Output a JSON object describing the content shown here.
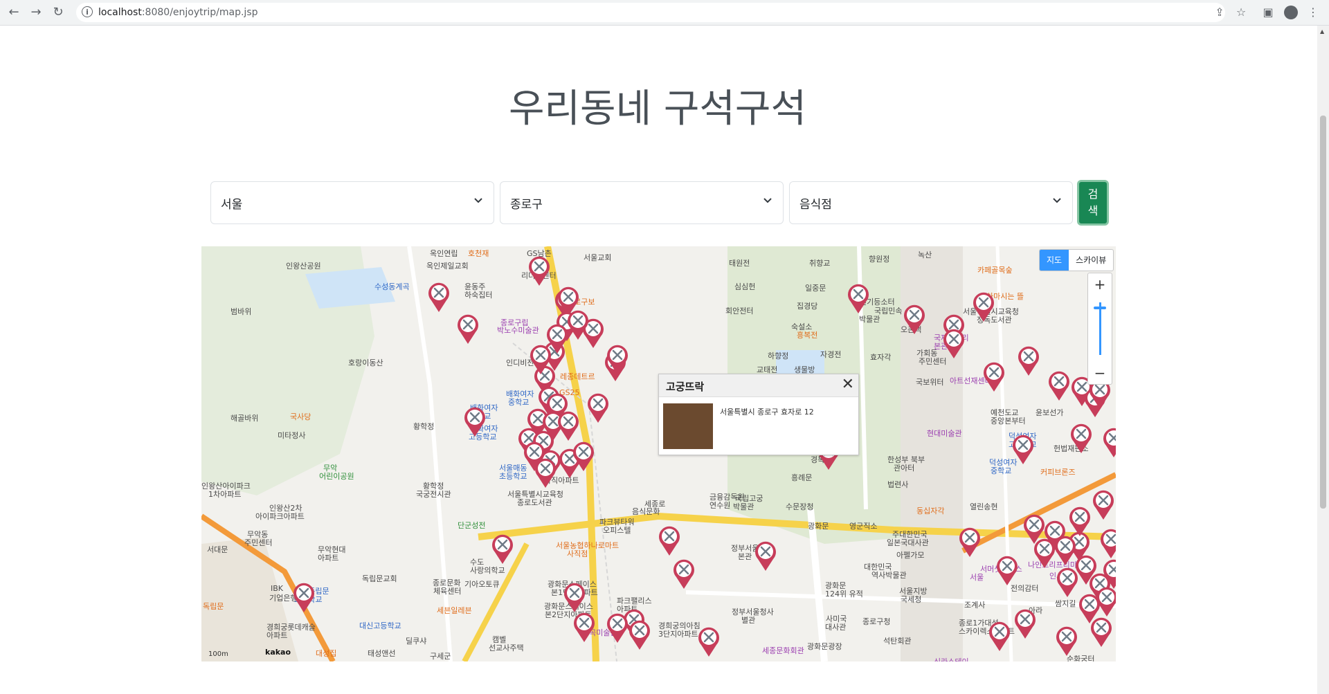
{
  "browser": {
    "url_host": "localhost",
    "url_rest": ":8080/enjoytrip/map.jsp"
  },
  "page": {
    "title": "우리동네 구석구석"
  },
  "filters": {
    "sido": "서울",
    "gugun": "종로구",
    "content_type": "음식점",
    "search_label": "검\n색"
  },
  "map": {
    "type_buttons": [
      "지도",
      "스카이뷰"
    ],
    "zoom_in": "+",
    "zoom_out": "−",
    "scale_text": "100m",
    "logo_text": "kakao",
    "popup": {
      "name": "고궁뜨락",
      "address": "서울특별시 종로구 효자로 12"
    },
    "labels": [
      {
        "text": "옥인연립",
        "cls": ""
      },
      {
        "text": "호천재",
        "cls": "orange"
      },
      {
        "text": "GS남촌",
        "cls": ""
      },
      {
        "text": "서울교회",
        "cls": ""
      },
      {
        "text": "인왕산공원",
        "cls": ""
      },
      {
        "text": "옥인제일교회",
        "cls": ""
      },
      {
        "text": "윤동주",
        "cls": ""
      },
      {
        "text": "하숙집터",
        "cls": ""
      },
      {
        "text": "수성동계곡",
        "cls": "blue"
      },
      {
        "text": "리더십센터",
        "cls": ""
      },
      {
        "text": "종로구보",
        "cls": "orange"
      },
      {
        "text": "범바위",
        "cls": ""
      },
      {
        "text": "종로구립",
        "cls": "purple"
      },
      {
        "text": "박노수미술관",
        "cls": "purple"
      },
      {
        "text": "인디비전",
        "cls": ""
      },
      {
        "text": "호랑이동산",
        "cls": ""
      },
      {
        "text": "레종데트르",
        "cls": "orange"
      },
      {
        "text": "배화여자",
        "cls": "blue"
      },
      {
        "text": "중학교",
        "cls": "blue"
      },
      {
        "text": "배화여자",
        "cls": "blue"
      },
      {
        "text": "대학교",
        "cls": "blue"
      },
      {
        "text": "GS25",
        "cls": "orange"
      },
      {
        "text": "해골바위",
        "cls": ""
      },
      {
        "text": "국사당",
        "cls": "orange"
      },
      {
        "text": "배화여자",
        "cls": "blue"
      },
      {
        "text": "고등학교",
        "cls": "blue"
      },
      {
        "text": "미타정사",
        "cls": ""
      },
      {
        "text": "황학정",
        "cls": ""
      },
      {
        "text": "무악",
        "cls": "green"
      },
      {
        "text": "어린이공원",
        "cls": "green"
      },
      {
        "text": "서울매동",
        "cls": "blue"
      },
      {
        "text": "초등학교",
        "cls": "blue"
      },
      {
        "text": "사직아파트",
        "cls": ""
      },
      {
        "text": "황학정",
        "cls": ""
      },
      {
        "text": "국궁전시관",
        "cls": ""
      },
      {
        "text": "서울특별시교육청",
        "cls": ""
      },
      {
        "text": "종로도서관",
        "cls": ""
      },
      {
        "text": "인왕산아이파크",
        "cls": ""
      },
      {
        "text": "1차아파트",
        "cls": ""
      },
      {
        "text": "인왕산2차",
        "cls": ""
      },
      {
        "text": "아이파크아파트",
        "cls": ""
      },
      {
        "text": "무악동",
        "cls": ""
      },
      {
        "text": "주민센터",
        "cls": ""
      },
      {
        "text": "단군성전",
        "cls": "green"
      },
      {
        "text": "파크뷰타워",
        "cls": ""
      },
      {
        "text": "오피스텔",
        "cls": ""
      },
      {
        "text": "무악현대",
        "cls": ""
      },
      {
        "text": "아파트",
        "cls": ""
      },
      {
        "text": "수도",
        "cls": ""
      },
      {
        "text": "사랑의학교",
        "cls": ""
      },
      {
        "text": "서울농협하나로마트",
        "cls": "orange"
      },
      {
        "text": "사직점",
        "cls": "orange"
      },
      {
        "text": "독립문교회",
        "cls": ""
      },
      {
        "text": "종로문화",
        "cls": ""
      },
      {
        "text": "체육센터",
        "cls": ""
      },
      {
        "text": "기아오토큐",
        "cls": ""
      },
      {
        "text": "광화문스페이스",
        "cls": ""
      },
      {
        "text": "본1단지아파트",
        "cls": ""
      },
      {
        "text": "파크팰리스",
        "cls": ""
      },
      {
        "text": "아파트",
        "cls": ""
      },
      {
        "text": "IBK",
        "cls": ""
      },
      {
        "text": "기업은행",
        "cls": ""
      },
      {
        "text": "서울독립문",
        "cls": "blue"
      },
      {
        "text": "초등학교",
        "cls": "blue"
      },
      {
        "text": "세븐일레븐",
        "cls": "orange"
      },
      {
        "text": "광화문스페이스",
        "cls": ""
      },
      {
        "text": "본2단지아파트",
        "cls": ""
      },
      {
        "text": "경희궁의아침",
        "cls": ""
      },
      {
        "text": "3단지아파트",
        "cls": ""
      },
      {
        "text": "경희궁롯데캐슬",
        "cls": ""
      },
      {
        "text": "아파트",
        "cls": ""
      },
      {
        "text": "대신고등학교",
        "cls": "blue"
      },
      {
        "text": "캠벨",
        "cls": ""
      },
      {
        "text": "선교사주택",
        "cls": ""
      },
      {
        "text": "성곡미술관",
        "cls": "purple"
      },
      {
        "text": "딜쿠샤",
        "cls": ""
      },
      {
        "text": "대성집",
        "cls": "orange"
      },
      {
        "text": "태성앤선",
        "cls": ""
      },
      {
        "text": "구세군",
        "cls": ""
      },
      {
        "text": "태원전",
        "cls": ""
      },
      {
        "text": "취향교",
        "cls": ""
      },
      {
        "text": "향원정",
        "cls": ""
      },
      {
        "text": "녹산",
        "cls": ""
      },
      {
        "text": "카페골목숲",
        "cls": "orange"
      },
      {
        "text": "심심헌",
        "cls": ""
      },
      {
        "text": "일중문",
        "cls": ""
      },
      {
        "text": "전기등소터",
        "cls": ""
      },
      {
        "text": "국립민속",
        "cls": ""
      },
      {
        "text": "박물관",
        "cls": ""
      },
      {
        "text": "차마시는 뜰",
        "cls": "orange"
      },
      {
        "text": "회안전터",
        "cls": ""
      },
      {
        "text": "집경당",
        "cls": ""
      },
      {
        "text": "서울특별시교육청",
        "cls": ""
      },
      {
        "text": "정독도서관",
        "cls": ""
      },
      {
        "text": "숙설소",
        "cls": ""
      },
      {
        "text": "흥복전",
        "cls": "orange"
      },
      {
        "text": "오촌택",
        "cls": ""
      },
      {
        "text": "국제갤러리",
        "cls": "purple"
      },
      {
        "text": "본관",
        "cls": "purple"
      },
      {
        "text": "하향정",
        "cls": ""
      },
      {
        "text": "자경전",
        "cls": ""
      },
      {
        "text": "교태전",
        "cls": ""
      },
      {
        "text": "생물방",
        "cls": ""
      },
      {
        "text": "효자각",
        "cls": ""
      },
      {
        "text": "가회동",
        "cls": ""
      },
      {
        "text": "주민센터",
        "cls": ""
      },
      {
        "text": "국보위터",
        "cls": ""
      },
      {
        "text": "아트선재센터",
        "cls": "purple"
      },
      {
        "text": "예천도교",
        "cls": ""
      },
      {
        "text": "중앙본부터",
        "cls": ""
      },
      {
        "text": "윤보선가",
        "cls": ""
      },
      {
        "text": "덕성여자",
        "cls": "blue"
      },
      {
        "text": "고등학교",
        "cls": "blue"
      },
      {
        "text": "헌법재판소",
        "cls": ""
      },
      {
        "text": "현대미술관",
        "cls": "purple"
      },
      {
        "text": "한성부 북부",
        "cls": ""
      },
      {
        "text": "관아터",
        "cls": ""
      },
      {
        "text": "경복궁",
        "cls": ""
      },
      {
        "text": "덕성여자",
        "cls": "blue"
      },
      {
        "text": "중학교",
        "cls": "blue"
      },
      {
        "text": "흥례문",
        "cls": ""
      },
      {
        "text": "법련사",
        "cls": ""
      },
      {
        "text": "커피브론즈",
        "cls": "orange"
      },
      {
        "text": "금융감독원",
        "cls": ""
      },
      {
        "text": "연수원",
        "cls": ""
      },
      {
        "text": "국립고궁",
        "cls": ""
      },
      {
        "text": "박물관",
        "cls": ""
      },
      {
        "text": "수문장청",
        "cls": ""
      },
      {
        "text": "동십자각",
        "cls": "orange"
      },
      {
        "text": "열린송현",
        "cls": ""
      },
      {
        "text": "광화문",
        "cls": ""
      },
      {
        "text": "영군직소",
        "cls": ""
      },
      {
        "text": "주대한민국",
        "cls": ""
      },
      {
        "text": "일본국대사관",
        "cls": ""
      },
      {
        "text": "정부서울",
        "cls": ""
      },
      {
        "text": "본관",
        "cls": ""
      },
      {
        "text": "아펠가모",
        "cls": ""
      },
      {
        "text": "대한민국",
        "cls": ""
      },
      {
        "text": "역사박물관",
        "cls": ""
      },
      {
        "text": "서머셋팰리스",
        "cls": "purple"
      },
      {
        "text": "서울",
        "cls": "purple"
      },
      {
        "text": "나인트리프리미어",
        "cls": "purple"
      },
      {
        "text": "인사동",
        "cls": "purple"
      },
      {
        "text": "광화문",
        "cls": ""
      },
      {
        "text": "124위 유적",
        "cls": ""
      },
      {
        "text": "서울지방",
        "cls": ""
      },
      {
        "text": "국세청",
        "cls": ""
      },
      {
        "text": "전의감터",
        "cls": ""
      },
      {
        "text": "쌈지길",
        "cls": ""
      },
      {
        "text": "정부서울청사",
        "cls": ""
      },
      {
        "text": "별관",
        "cls": ""
      },
      {
        "text": "사미국",
        "cls": ""
      },
      {
        "text": "대사관",
        "cls": ""
      },
      {
        "text": "종로구청",
        "cls": ""
      },
      {
        "text": "조계사",
        "cls": ""
      },
      {
        "text": "아라",
        "cls": ""
      },
      {
        "text": "종로1가대성",
        "cls": ""
      },
      {
        "text": "스카이렉스아파트",
        "cls": ""
      },
      {
        "text": "석탄회관",
        "cls": ""
      },
      {
        "text": "세종문화회관",
        "cls": "purple"
      },
      {
        "text": "광화문광장",
        "cls": ""
      },
      {
        "text": "신라스테이",
        "cls": "purple"
      },
      {
        "text": "순화궁터",
        "cls": ""
      },
      {
        "text": "세종로",
        "cls": ""
      },
      {
        "text": "음식문화",
        "cls": ""
      },
      {
        "text": "독립문",
        "cls": "orange"
      },
      {
        "text": "서대문",
        "cls": ""
      }
    ]
  }
}
